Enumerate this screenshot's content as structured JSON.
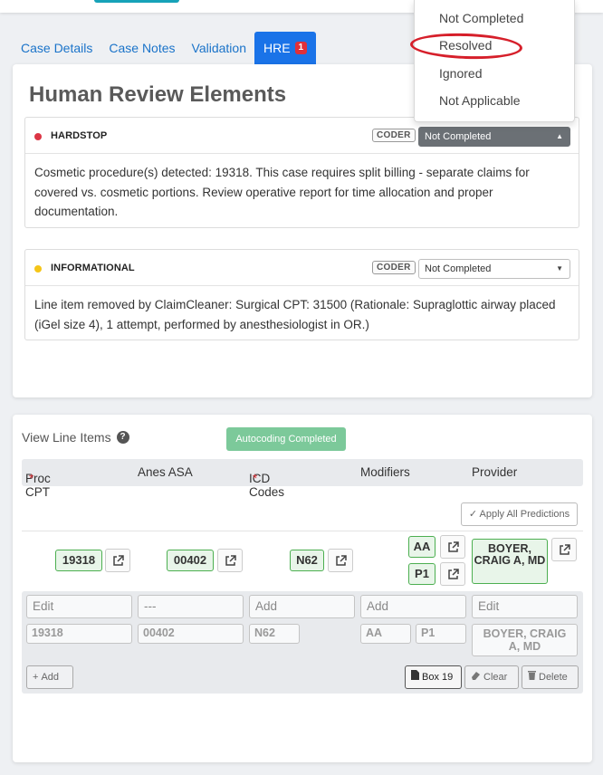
{
  "tabs": [
    {
      "label": "Case Details"
    },
    {
      "label": "Case Notes"
    },
    {
      "label": "Validation"
    },
    {
      "label": "HRE",
      "badge": "1"
    }
  ],
  "hre": {
    "title": "Human Review Elements",
    "elements": [
      {
        "type": "HARDSTOP",
        "dot_color": "#dc3545",
        "role": "CODER",
        "status": "Not Completed",
        "text": "Cosmetic procedure(s) detected: 19318. This case requires split billing - separate claims for covered vs. cosmetic portions. Review operative report for time allocation and proper documentation."
      },
      {
        "type": "INFORMATIONAL",
        "dot_color": "#f5c518",
        "role": "CODER",
        "status": "Not Completed",
        "text": "Line item removed by ClaimCleaner: Surgical CPT: 31500 (Rationale: Supraglottic airway placed (iGel size 4), 1 attempt, performed by anesthesiologist in OR.)"
      }
    ],
    "dropdown_options": [
      "Not Completed",
      "Resolved",
      "Ignored",
      "Not Applicable"
    ]
  },
  "line_items": {
    "title": "View Line Items",
    "autocoding_badge": "Autocoding Completed",
    "columns": [
      "Proc CPT",
      "Anes ASA",
      "ICD Codes",
      "Modifiers",
      "Provider"
    ],
    "apply_button": "Apply All Predictions",
    "prediction": {
      "cpt": "19318",
      "asa": "00402",
      "icd": "N62",
      "modifiers": [
        "AA",
        "P1"
      ],
      "provider": "BOYER, CRAIG A, MD"
    },
    "edit_placeholders": [
      "Edit",
      "---",
      "Add",
      "Add",
      "Edit"
    ],
    "current": {
      "cpt": "19318",
      "asa": "00402",
      "icd": "N62",
      "modifiers": [
        "AA",
        "P1"
      ],
      "provider": "BOYER, CRAIG A, MD"
    },
    "buttons": {
      "add": "Add",
      "box": "Box 19",
      "clear": "Clear",
      "delete": "Delete"
    }
  },
  "colors": {
    "accent": "#1a73e8",
    "success": "#4caf50",
    "danger": "#dc3545"
  }
}
